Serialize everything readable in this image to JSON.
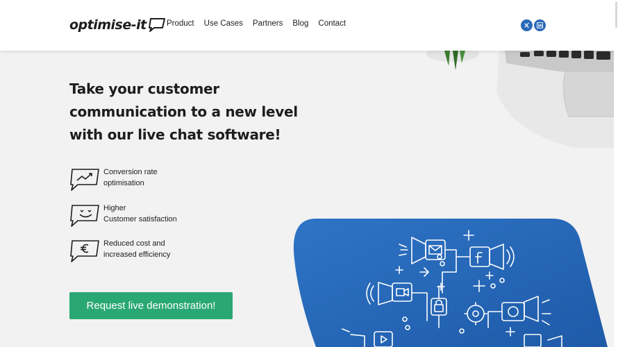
{
  "header": {
    "logo_text": "optimise-it",
    "nav": [
      "Product",
      "Use Cases",
      "Partners",
      "Blog",
      "Contact"
    ],
    "social": [
      {
        "icon": "xing-icon",
        "glyph": "X"
      },
      {
        "icon": "linkedin-icon",
        "glyph": "in"
      }
    ]
  },
  "hero": {
    "title_lines": [
      "Take your customer",
      "communication to a new level",
      "with our live chat software!"
    ]
  },
  "features": [
    {
      "icon": "trend-chart-bubble-icon",
      "line1": "Conversion rate",
      "line2": "optimisation"
    },
    {
      "icon": "smiley-bubble-icon",
      "line1": "Higher",
      "line2": "Customer satisfaction"
    },
    {
      "icon": "euro-bubble-icon",
      "line1": "Reduced cost and",
      "line2": "increased efficiency"
    }
  ],
  "cta": {
    "label": "Request live demonstration!"
  },
  "colors": {
    "accent_green": "#2aa873",
    "brand_blue": "#2a69b8",
    "text_dark": "#1d1d1b",
    "background": "#f2f2f2"
  }
}
